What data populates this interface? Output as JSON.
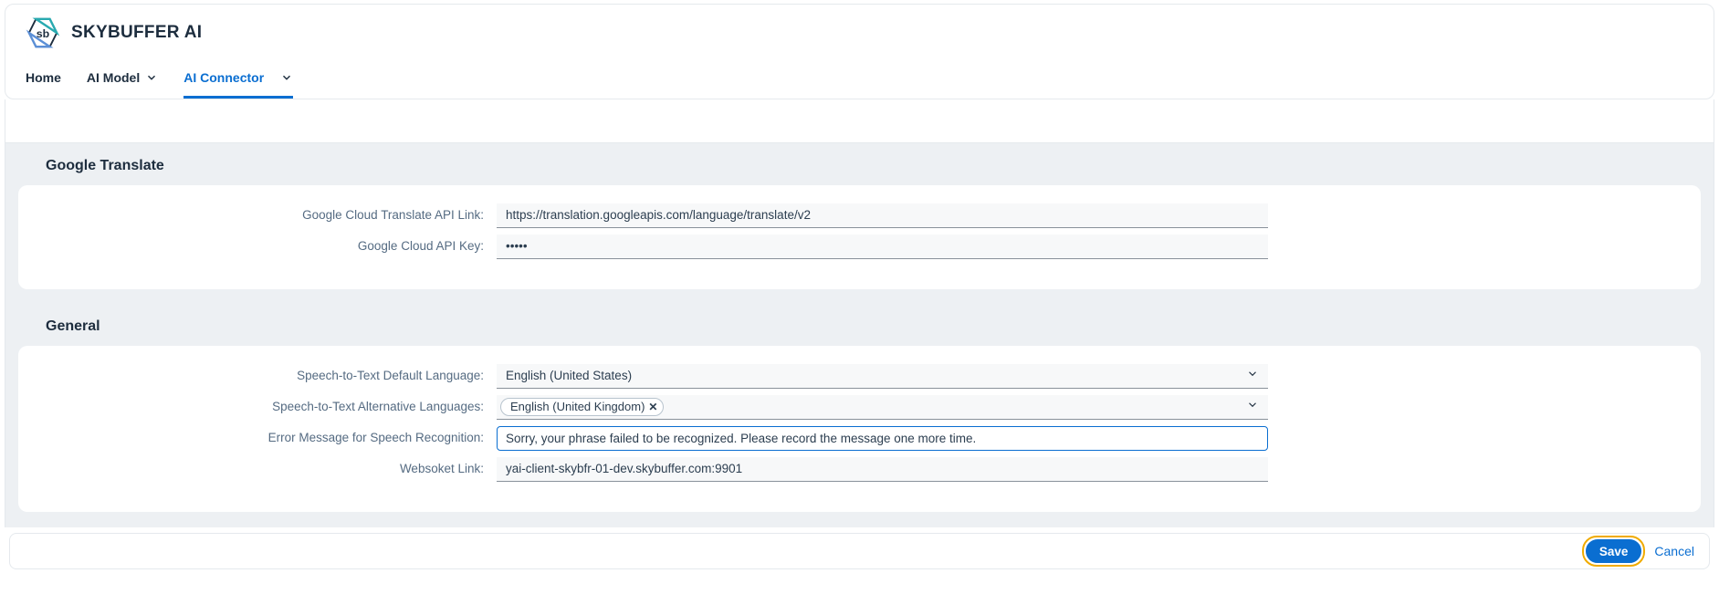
{
  "header": {
    "app_title": "SKYBUFFER AI"
  },
  "tabs": {
    "home": "Home",
    "ai_model": "AI Model",
    "ai_connector": "AI Connector"
  },
  "sections": {
    "google_translate": {
      "title": "Google Translate",
      "fields": {
        "api_link": {
          "label": "Google Cloud Translate API Link:",
          "value": "https://translation.googleapis.com/language/translate/v2"
        },
        "api_key": {
          "label": "Google Cloud API Key:",
          "value": "•••••"
        }
      }
    },
    "general": {
      "title": "General",
      "fields": {
        "default_lang": {
          "label": "Speech-to-Text Default Language:",
          "value": "English (United States)"
        },
        "alt_langs": {
          "label": "Speech-to-Text Alternative Languages:",
          "tokens": [
            "English (United Kingdom)"
          ]
        },
        "error_msg": {
          "label": "Error Message for Speech Recognition:",
          "value": "Sorry, your phrase failed to be recognized. Please record the message one more time."
        },
        "websocket": {
          "label": "Websoket Link:",
          "value": "yai-client-skybfr-01-dev.skybuffer.com:9901"
        }
      }
    }
  },
  "footer": {
    "save": "Save",
    "cancel": "Cancel"
  }
}
